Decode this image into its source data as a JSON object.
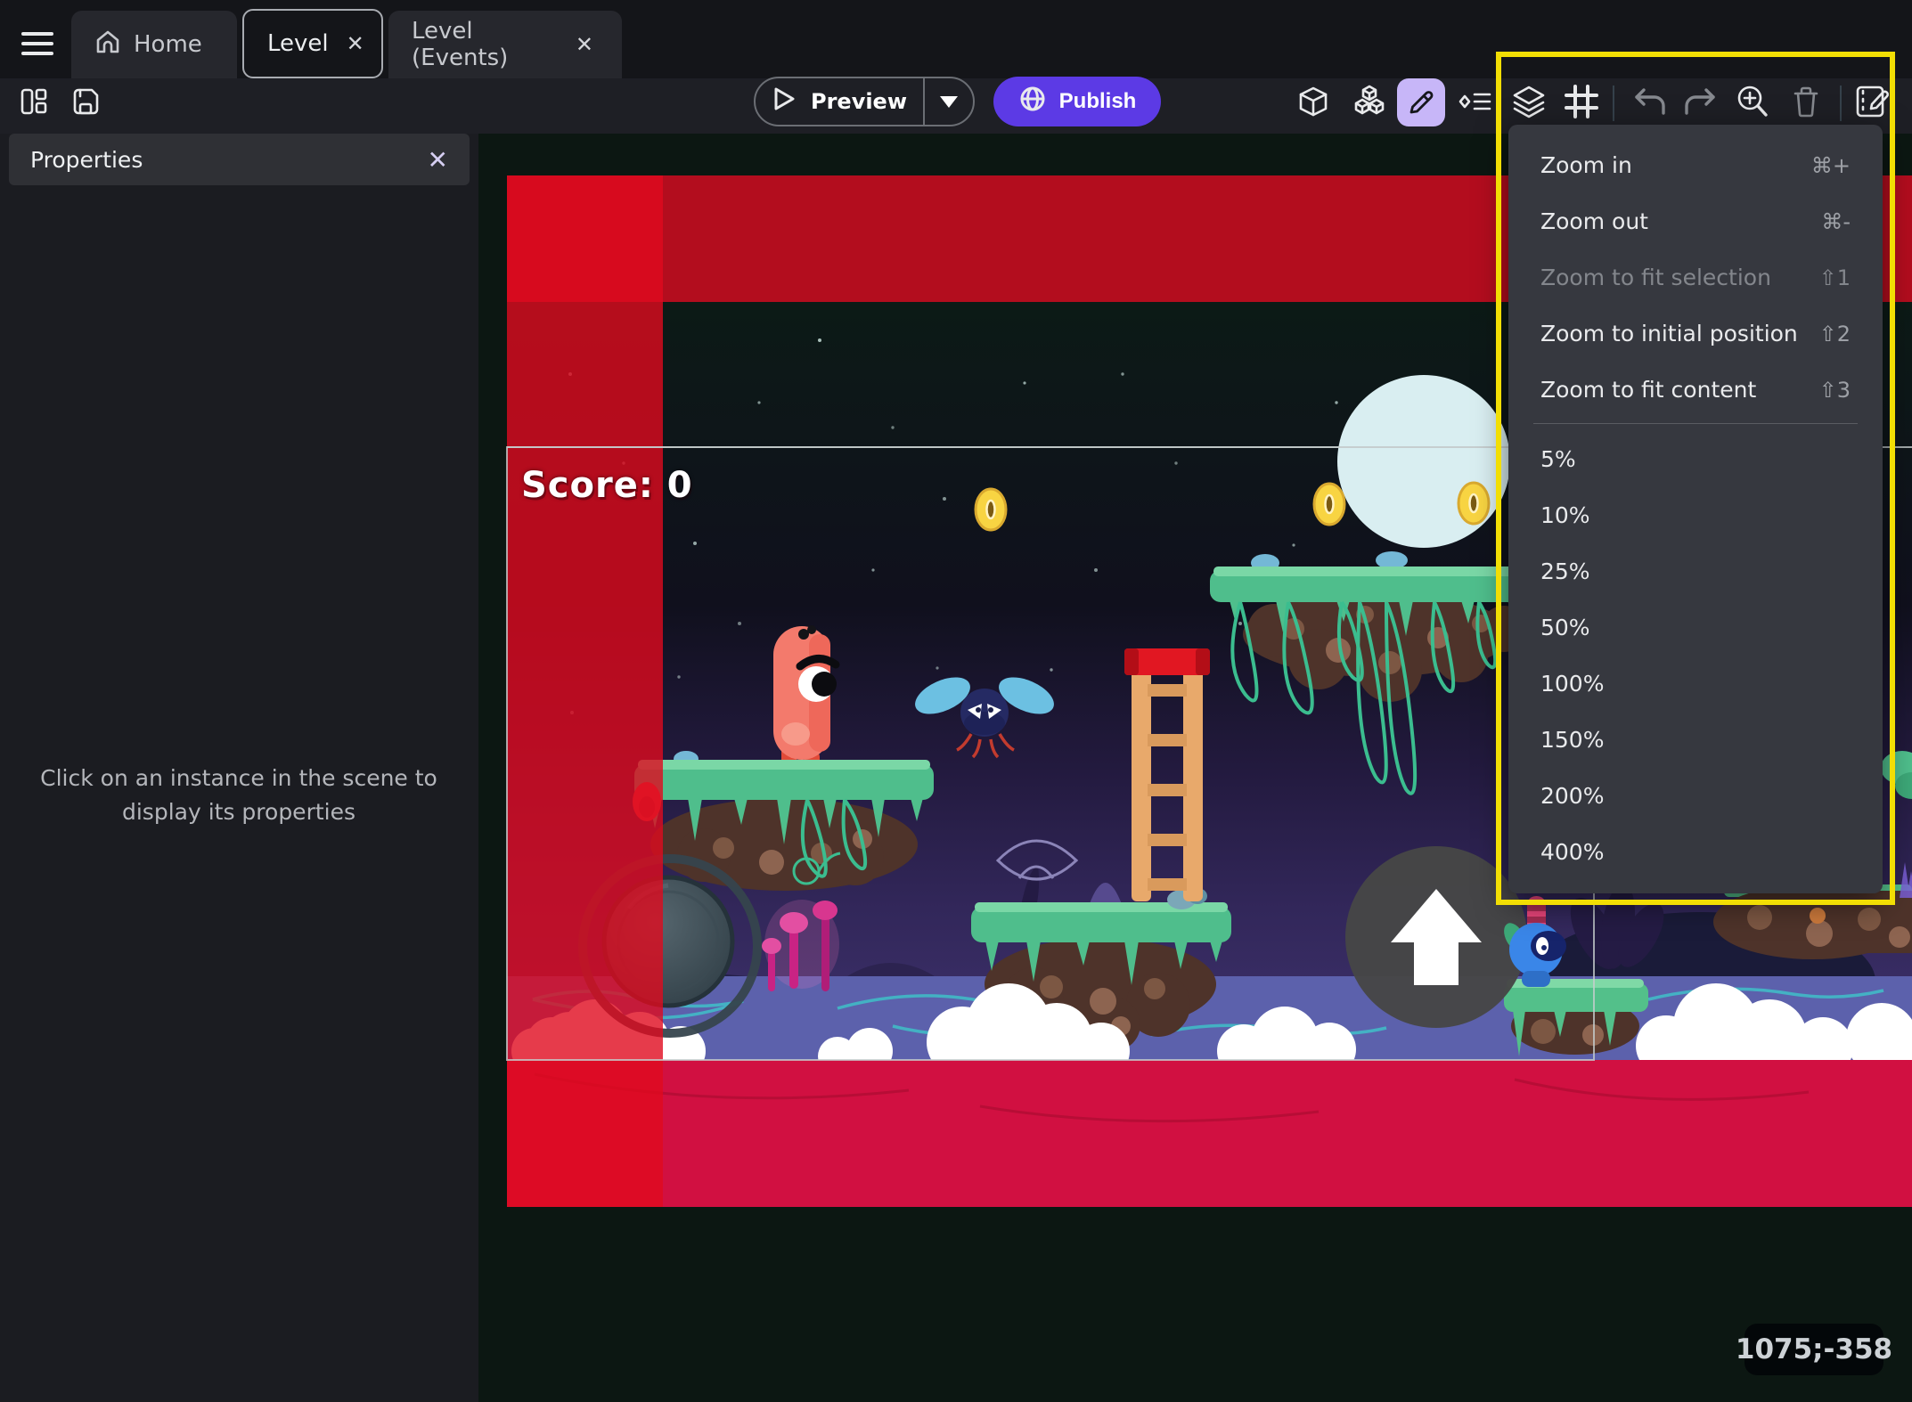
{
  "window": {
    "tabs": [
      {
        "label": "Home"
      },
      {
        "label": "Level"
      },
      {
        "label": "Level (Events)"
      }
    ]
  },
  "toolbar": {
    "preview_label": "Preview",
    "publish_label": "Publish"
  },
  "panel": {
    "title": "Properties",
    "empty_message": "Click on an instance in the scene to display its properties"
  },
  "scene": {
    "score_label": "Score: 0",
    "coordinates": "1075;-358"
  },
  "menu": {
    "items": [
      {
        "label": "Zoom in",
        "shortcut": "⌘+"
      },
      {
        "label": "Zoom out",
        "shortcut": "⌘-"
      },
      {
        "label": "Zoom to fit selection",
        "shortcut": "⇧1"
      },
      {
        "label": "Zoom to initial position",
        "shortcut": "⇧2"
      },
      {
        "label": "Zoom to fit content",
        "shortcut": "⇧3"
      }
    ],
    "zoom_levels": [
      "5%",
      "10%",
      "25%",
      "50%",
      "100%",
      "150%",
      "200%",
      "400%"
    ]
  },
  "icons": {
    "close": "✕"
  },
  "colors": {
    "accent_purple": "#5c3ae5",
    "selection_lilac": "#c7b6f8",
    "highlight_yellow": "#f2de04",
    "top_band_red": "#b30d1e",
    "border_red": "#e00a1e",
    "bottom_band_red": "#d11041"
  }
}
